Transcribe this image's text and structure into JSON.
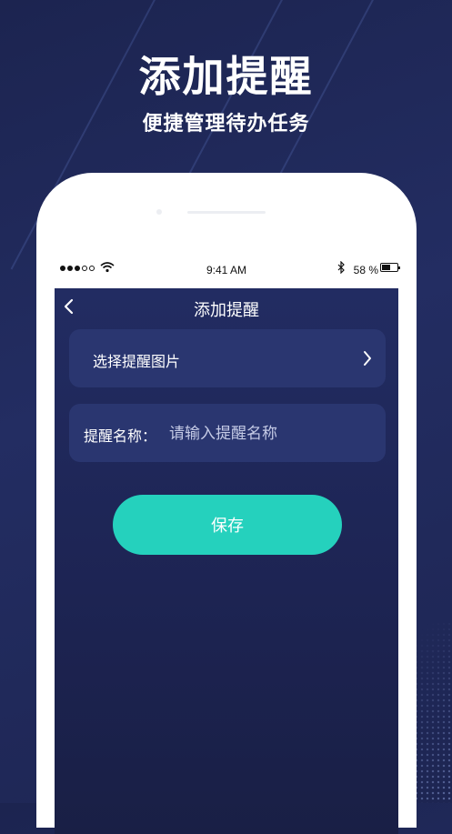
{
  "promo": {
    "headline": "添加提醒",
    "subline": "便捷管理待办任务"
  },
  "status_bar": {
    "time": "9:41 AM",
    "battery_percent": "58 %",
    "battery_level": 0.58,
    "signal_bars_filled": 3,
    "signal_bars_total": 5
  },
  "navbar": {
    "title": "添加提醒",
    "back_icon": "chevron-left-icon"
  },
  "form": {
    "pick_image_label": "选择提醒图片",
    "pick_image_icon": "chevron-right-icon",
    "name_label": "提醒名称：",
    "name_value": "",
    "name_placeholder": "请输入提醒名称",
    "save_label": "保存"
  },
  "colors": {
    "background": "#1e2656",
    "card": "#2a3670",
    "accent": "#25d1bd"
  }
}
